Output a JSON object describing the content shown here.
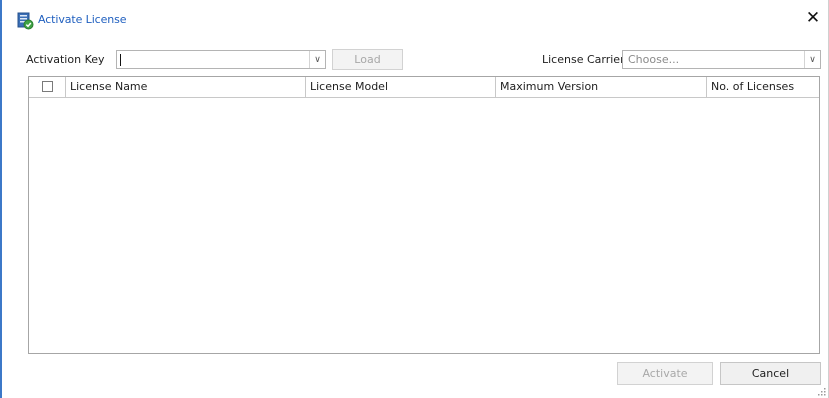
{
  "window": {
    "title": "Activate License",
    "close_label": "✕"
  },
  "form": {
    "activation_key_label": "Activation Key",
    "activation_key_value": "",
    "load_label": "Load",
    "license_carrier_label": "License Carrier",
    "license_carrier_placeholder": "Choose..."
  },
  "table": {
    "columns": [
      "License Name",
      "License Model",
      "Maximum Version",
      "No. of Licenses"
    ],
    "rows": []
  },
  "footer": {
    "activate_label": "Activate",
    "cancel_label": "Cancel"
  },
  "icons": {
    "title": "license-certificate-icon",
    "dropdown": "chevron-down-icon",
    "close": "close-icon",
    "resize": "resize-grip-icon"
  },
  "colors": {
    "title_text": "#1f5fbf",
    "window_border": "#3c78c8",
    "disabled_text": "#a8a8a8"
  }
}
